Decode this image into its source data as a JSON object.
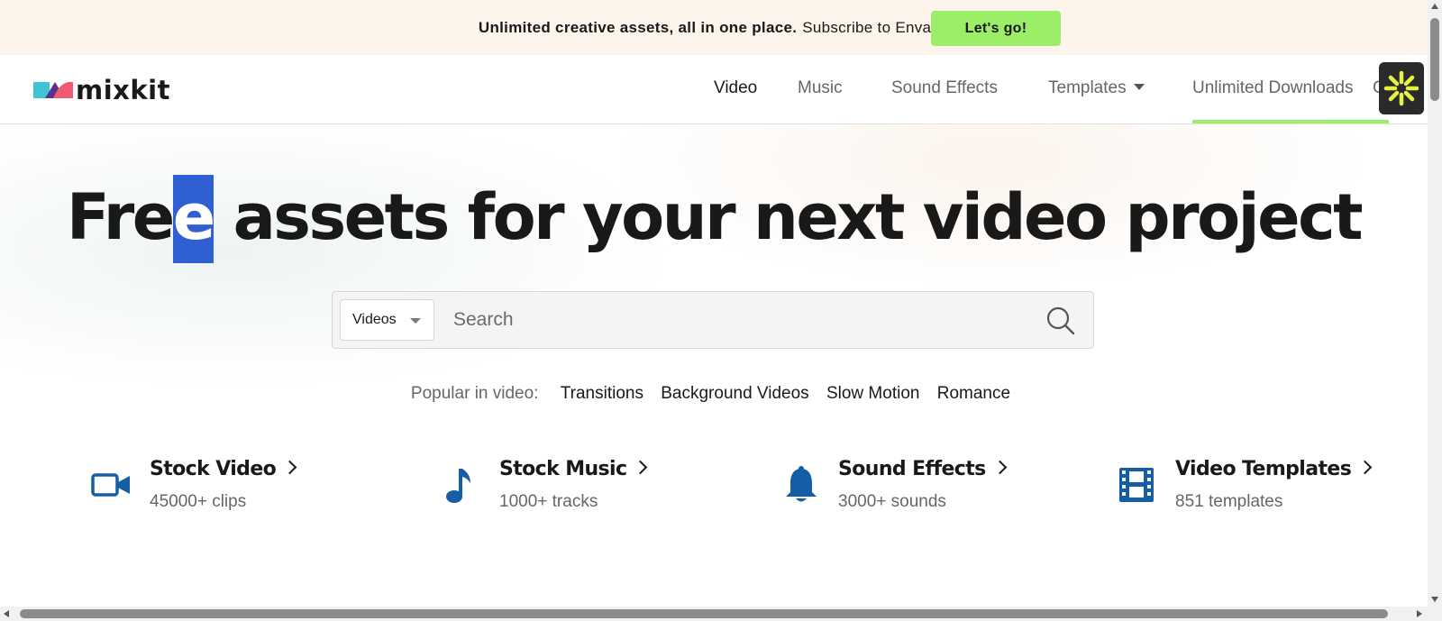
{
  "promo": {
    "strong": "Unlimited creative assets, all in one place.",
    "rest": "Subscribe to Envato.",
    "button": "Let's go!"
  },
  "header": {
    "logo_text": "mixkit",
    "nav": [
      {
        "label": "Video",
        "active": true
      },
      {
        "label": "Music",
        "active": false
      },
      {
        "label": "Sound Effects",
        "active": false
      },
      {
        "label": "Templates",
        "active": false
      },
      {
        "label": "Unlimited Downloads",
        "active": false
      }
    ],
    "nav_truncated": "C",
    "accent_color": "#9cee69"
  },
  "hero": {
    "title_before": "Fre",
    "title_selected": "e",
    "title_after": " assets for your next video project"
  },
  "search": {
    "category": "Videos",
    "placeholder": "Search",
    "value": ""
  },
  "popular": {
    "label": "Popular in video:",
    "links": [
      "Transitions",
      "Background Videos",
      "Slow Motion",
      "Romance"
    ]
  },
  "categories": [
    {
      "title": "Stock Video",
      "subtitle": "45000+ clips",
      "icon": "video-camera-icon"
    },
    {
      "title": "Stock Music",
      "subtitle": "1000+ tracks",
      "icon": "music-note-icon"
    },
    {
      "title": "Sound Effects",
      "subtitle": "3000+ sounds",
      "icon": "bell-icon"
    },
    {
      "title": "Video Templates",
      "subtitle": "851 templates",
      "icon": "film-strip-icon"
    }
  ],
  "icon_color": "#155ea5"
}
